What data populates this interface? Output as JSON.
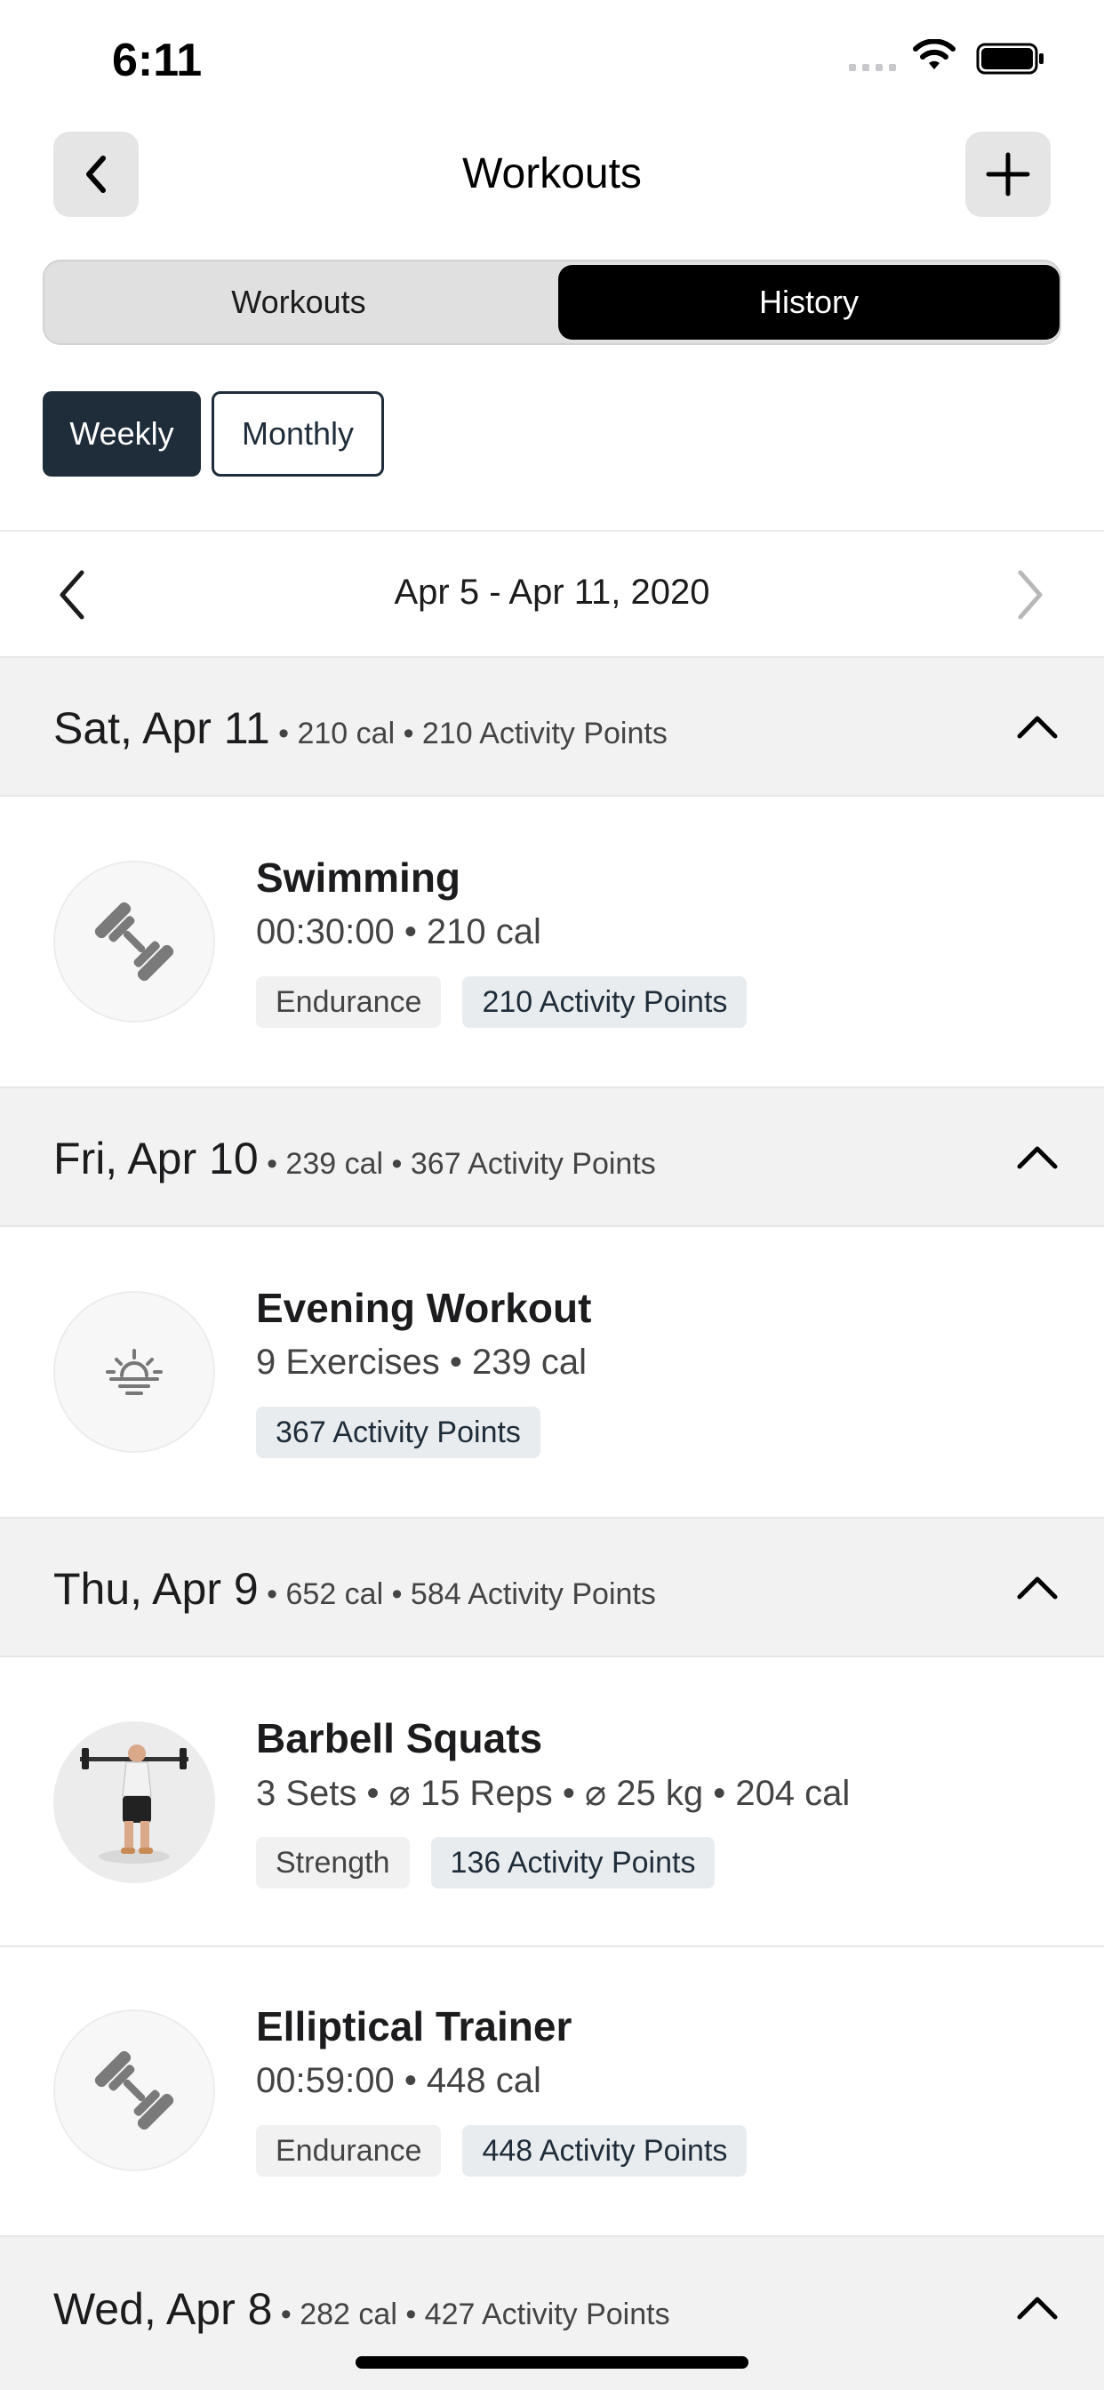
{
  "status_bar": {
    "time": "6:11",
    "icons": [
      "signal-dots-icon",
      "wifi-icon",
      "battery-icon"
    ]
  },
  "nav": {
    "title": "Workouts",
    "back_icon": "chevron-left-icon",
    "add_icon": "plus-icon"
  },
  "segments": {
    "items": [
      "Workouts",
      "History"
    ],
    "selected": "History"
  },
  "period_filter": {
    "items": [
      "Weekly",
      "Monthly"
    ],
    "selected": "Weekly"
  },
  "week": {
    "label": "Apr 5 - Apr 11, 2020"
  },
  "days": [
    {
      "title": "Sat, Apr 11",
      "meta": " • 210 cal • 210 Activity Points",
      "entries": [
        {
          "name": "Swimming",
          "sub": "00:30:00 • 210 cal",
          "tags": [
            "Endurance",
            "210 Activity Points"
          ],
          "icon": "dumbbell-icon"
        }
      ]
    },
    {
      "title": "Fri, Apr 10",
      "meta": " • 239 cal • 367 Activity Points",
      "entries": [
        {
          "name": "Evening Workout",
          "sub": "9 Exercises • 239 cal",
          "tags": [
            "367 Activity Points"
          ],
          "icon": "sunset-icon"
        }
      ]
    },
    {
      "title": "Thu, Apr 9",
      "meta": " • 652 cal • 584 Activity Points",
      "entries": [
        {
          "name": "Barbell Squats",
          "sub": "3 Sets • ⌀ 15 Reps • ⌀ 25 kg • 204 cal",
          "tags": [
            "Strength",
            "136 Activity Points"
          ],
          "icon": "barbell-squat-figure"
        },
        {
          "name": "Elliptical Trainer",
          "sub": "00:59:00 • 448 cal",
          "tags": [
            "Endurance",
            "448 Activity Points"
          ],
          "icon": "dumbbell-icon"
        }
      ]
    },
    {
      "title": "Wed, Apr 8",
      "meta": " • 282 cal • 427 Activity Points",
      "entries": []
    }
  ],
  "colors": {
    "primary_dark": "#1f2d3a",
    "segment_selected": "#000000",
    "header_bg": "#f2f2f2"
  }
}
